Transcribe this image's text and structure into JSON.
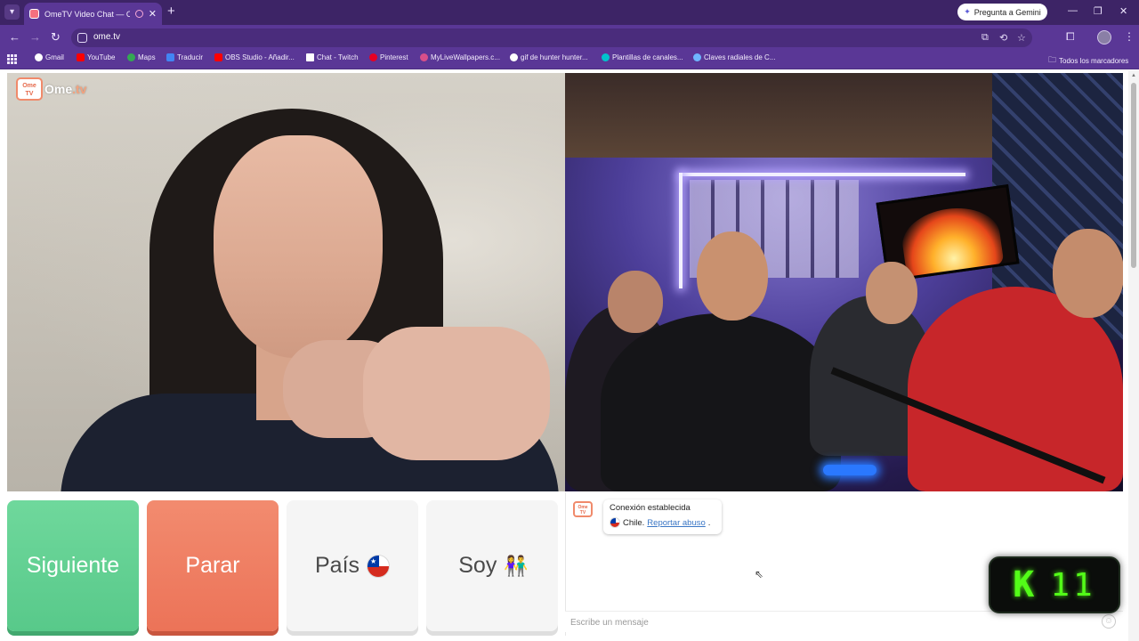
{
  "browser": {
    "tab_title": "OmeTV Video Chat — Ome",
    "new_tab_label": "+",
    "gemini_label": "Pregunta a Gemini",
    "url": "ome.tv",
    "nav": {
      "back": "←",
      "forward": "→",
      "reload": "↻"
    },
    "window": {
      "minimize": "—",
      "restore": "❐",
      "close": "✕"
    },
    "bookmarks": [
      {
        "label": "Gmail",
        "icon": "google-icon",
        "color": "#ffffff"
      },
      {
        "label": "YouTube",
        "icon": "youtube-icon",
        "color": "#ff0000"
      },
      {
        "label": "Maps",
        "icon": "maps-icon",
        "color": "#34a853"
      },
      {
        "label": "Traducir",
        "icon": "translate-icon",
        "color": "#4285f4"
      },
      {
        "label": "OBS Studio - Añadir...",
        "icon": "youtube-icon",
        "color": "#ff0000"
      },
      {
        "label": "Chat - Twitch",
        "icon": "twitch-icon",
        "color": "#ffffff"
      },
      {
        "label": "Pinterest",
        "icon": "pinterest-icon",
        "color": "#e60023"
      },
      {
        "label": "MyLiveWallpapers.c...",
        "icon": "wallpaper-icon",
        "color": "#d94f8a"
      },
      {
        "label": "gif de hunter hunter...",
        "icon": "google-icon",
        "color": "#ffffff"
      },
      {
        "label": "Plantillas de canales...",
        "icon": "canva-icon",
        "color": "#00c4cc"
      },
      {
        "label": "Claves radiales de C...",
        "icon": "site-icon",
        "color": "#6fb6ff"
      }
    ],
    "all_bookmarks": "Todos los marcadores"
  },
  "logo": {
    "name": "Ome",
    "tld": ".tv",
    "badge": "Ome TV"
  },
  "controls": {
    "next": "Siguiente",
    "stop": "Parar",
    "country": "País",
    "gender": "Soy",
    "gender_icon": "👫"
  },
  "chat": {
    "status": "Conexión establecida",
    "country": "Chile.",
    "report": "Reportar abuso",
    "report_suffix": ".",
    "placeholder": "Escribe un mensaje"
  },
  "overlay": {
    "kick_letter": "K",
    "counter": "11"
  },
  "colors": {
    "tab_bar": "#3d2466",
    "toolbar": "#5a3796",
    "next_button": "#58c98a",
    "stop_button": "#ec7358",
    "kick_green": "#53fc18",
    "report_link": "#3a76c5"
  }
}
